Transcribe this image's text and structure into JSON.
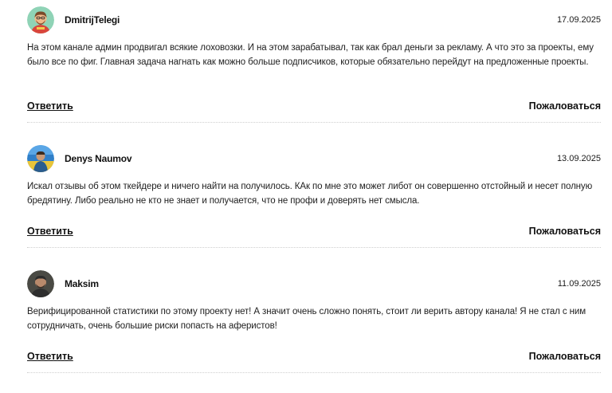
{
  "comments": [
    {
      "author": "DmitrijTelegi",
      "date": "17.09.2025",
      "avatar_icon": "user-avatar-cartoon",
      "text": "На этом канале админ продвигал всякие лоховозки. И на этом зарабатывал, так как брал деньги за рекламу. А что это за проекты, ему было все по фиг. Главная задача нагнать как можно больше подписчиков, которые обязательно перейдут на предложенные проекты.",
      "reply_label": "Ответить",
      "report_label": "Пожаловаться"
    },
    {
      "author": "Denys Naumov",
      "date": "13.09.2025",
      "avatar_icon": "user-avatar-photo",
      "text": "Искал отзывы об этом ткейдере и ничего найти на получилось. КАк по мне это может либот он совершенно отстойный и несет полную бредятину. Либо реально не кто не знает и получается, что не профи и доверять нет смысла.",
      "reply_label": "Ответить",
      "report_label": "Пожаловаться"
    },
    {
      "author": "Maksim",
      "date": "11.09.2025",
      "avatar_icon": "user-avatar-photo",
      "text": "Верифицированной статистики по этому проекту нет! А значит очень сложно понять, стоит ли верить автору канала! Я не стал с ним сотрудничать, очень большие риски попасть на аферистов!",
      "reply_label": "Ответить",
      "report_label": "Пожаловаться"
    }
  ]
}
